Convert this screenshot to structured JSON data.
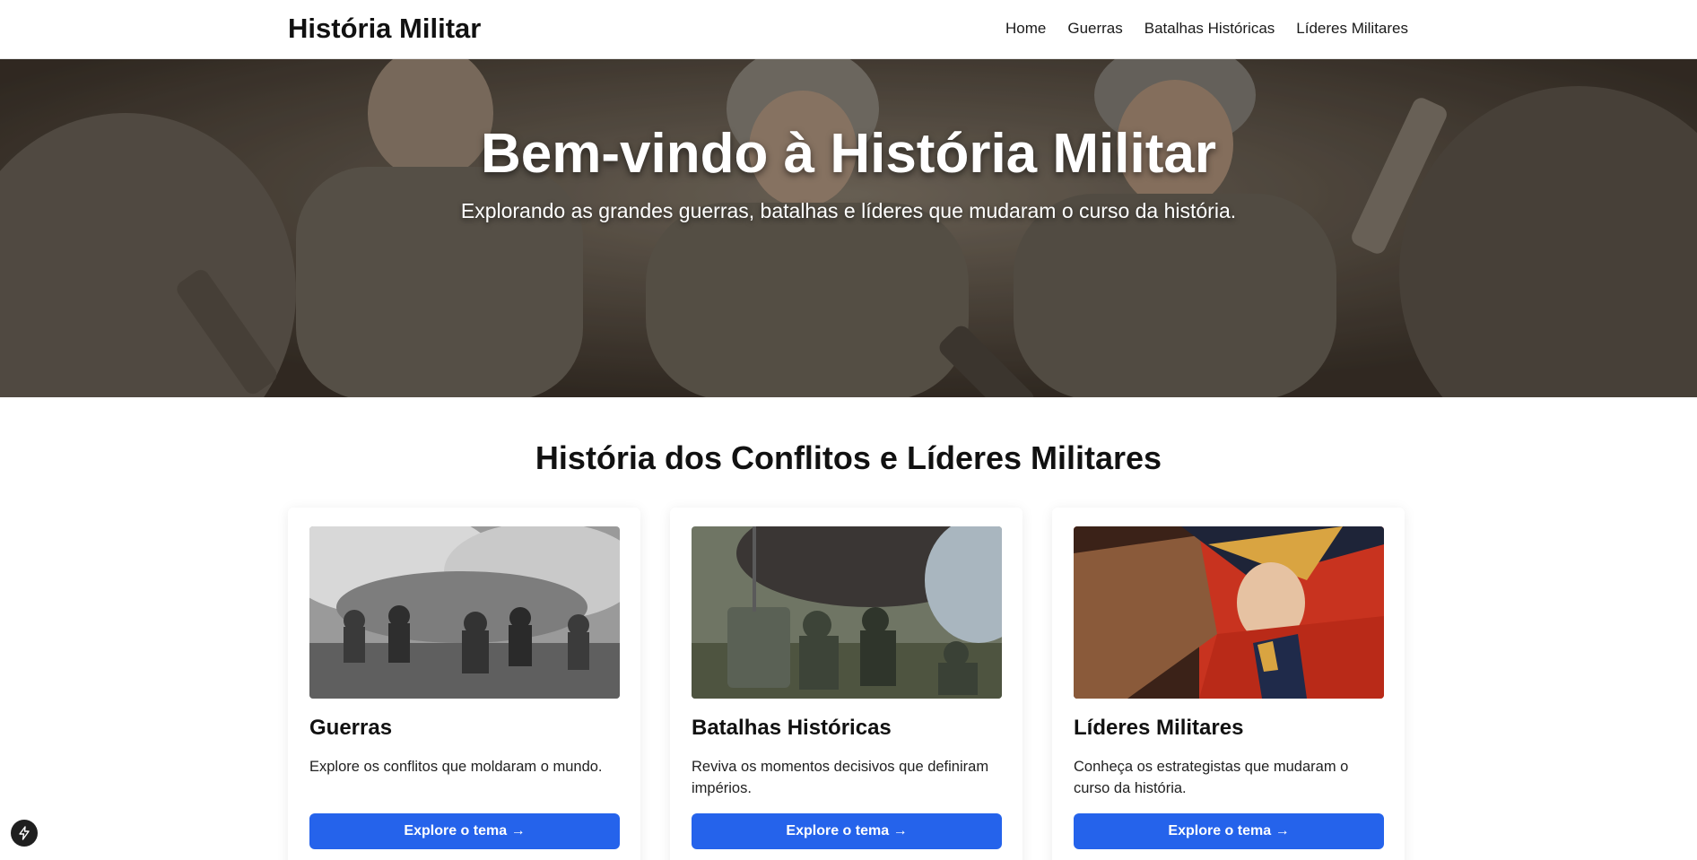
{
  "header": {
    "brand": "História Militar",
    "nav": [
      "Home",
      "Guerras",
      "Batalhas Históricas",
      "Líderes Militares"
    ]
  },
  "hero": {
    "title": "Bem-vindo à História Militar",
    "subtitle": "Explorando as grandes guerras, batalhas e líderes que mudaram o curso da história."
  },
  "section": {
    "title": "História dos Conflitos e Líderes Militares"
  },
  "cards": [
    {
      "title": "Guerras",
      "description": "Explore os conflitos que moldaram o mundo.",
      "button": "Explore o tema →"
    },
    {
      "title": "Batalhas Históricas",
      "description": "Reviva os momentos decisivos que definiram impérios.",
      "button": "Explore o tema →"
    },
    {
      "title": "Líderes Militares",
      "description": "Conheça os estrategistas que mudaram o curso da história.",
      "button": "Explore o tema →"
    }
  ],
  "colors": {
    "accent": "#2563eb",
    "text": "#111111",
    "background": "#ffffff"
  },
  "icons": {
    "dev_badge": "lightning-bolt-icon"
  }
}
